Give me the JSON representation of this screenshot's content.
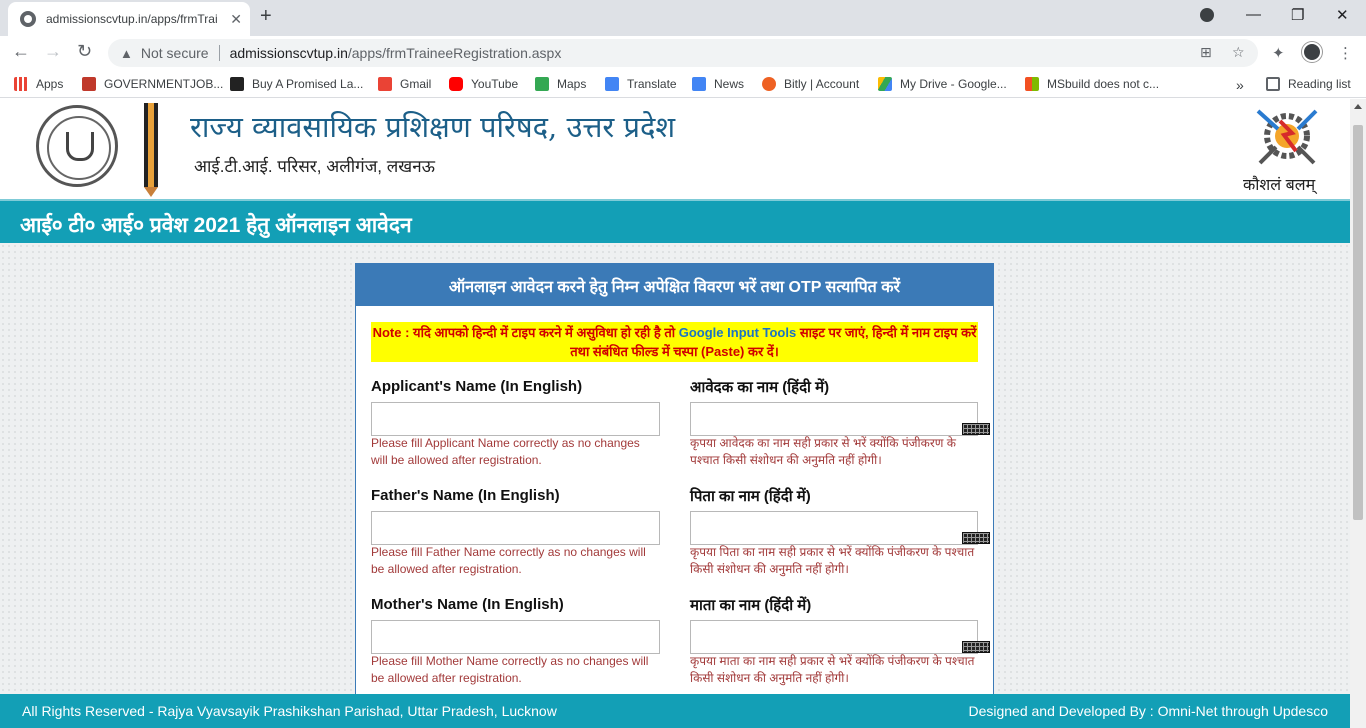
{
  "browser": {
    "tab_title": "admissionscvtup.in/apps/frmTrai",
    "not_secure": "Not secure",
    "url_domain": "admissionscvtup.in",
    "url_path": "/apps/frmTraineeRegistration.aspx",
    "bookmarks": [
      "Apps",
      "GOVERNMENTJOB...",
      "Buy A Promised La...",
      "Gmail",
      "YouTube",
      "Maps",
      "Translate",
      "News",
      "Bitly | Account",
      "My Drive - Google...",
      "MSbuild does not c..."
    ],
    "reading_list": "Reading list"
  },
  "header": {
    "org_name": "राज्य व्यावसायिक प्रशिक्षण परिषद, उत्तर प्रदेश",
    "org_address": "आई.टी.आई. परिसर, अलीगंज, लखनऊ",
    "logo_caption": "कौशलं बलम्"
  },
  "banner": "आई० टी० आई० प्रवेश 2021 हेतु ऑनलाइन आवेदन",
  "form": {
    "title": "ऑनलाइन आवेदन करने हेतु निम्न अपेक्षित विवरण भरें तथा OTP सत्यापित करें",
    "note_prefix": "Note : यदि आपको हिन्दी में टाइप करने में असुविधा हो रही है तो",
    "note_link": "Google Input Tools",
    "note_suffix": "साइट पर जाएं, हिन्दी में नाम टाइप करें तथा संबंधित फील्ड में चस्पा (Paste) कर दें।",
    "fields": [
      {
        "en_label": "Applicant's Name (In English)",
        "en_value": "",
        "en_hint": "Please fill Applicant Name correctly as no changes will be allowed after registration.",
        "hi_label": "आवेदक का नाम (हिंदी में)",
        "hi_value": "",
        "hi_hint": "कृपया आवेदक का नाम सही प्रकार से भरें क्योंकि पंजीकरण के पश्चात किसी संशोधन की अनुमति नहीं होगी।"
      },
      {
        "en_label": "Father's Name (In English)",
        "en_value": "",
        "en_hint": "Please fill Father Name correctly as no changes will be allowed after registration.",
        "hi_label": "पिता का नाम (हिंदी में)",
        "hi_value": "",
        "hi_hint": "कृपया पिता का नाम सही प्रकार से भरें क्योंकि पंजीकरण के पश्चात किसी संशोधन की अनुमति नहीं होगी।"
      },
      {
        "en_label": "Mother's Name (In English)",
        "en_value": "",
        "en_hint": "Please fill Mother Name correctly as no changes will be allowed after registration.",
        "hi_label": "माता का नाम (हिंदी में)",
        "hi_value": "",
        "hi_hint": "कृपया माता का नाम सही प्रकार से भरें क्योंकि पंजीकरण के पश्चात किसी संशोधन की अनुमति नहीं होगी।"
      }
    ]
  },
  "footer": {
    "left": "All Rights Reserved - Rajya Vyavsayik Prashikshan Parishad, Uttar Pradesh, Lucknow",
    "right": "Designed and Developed By : Omni-Net through Updesco"
  }
}
